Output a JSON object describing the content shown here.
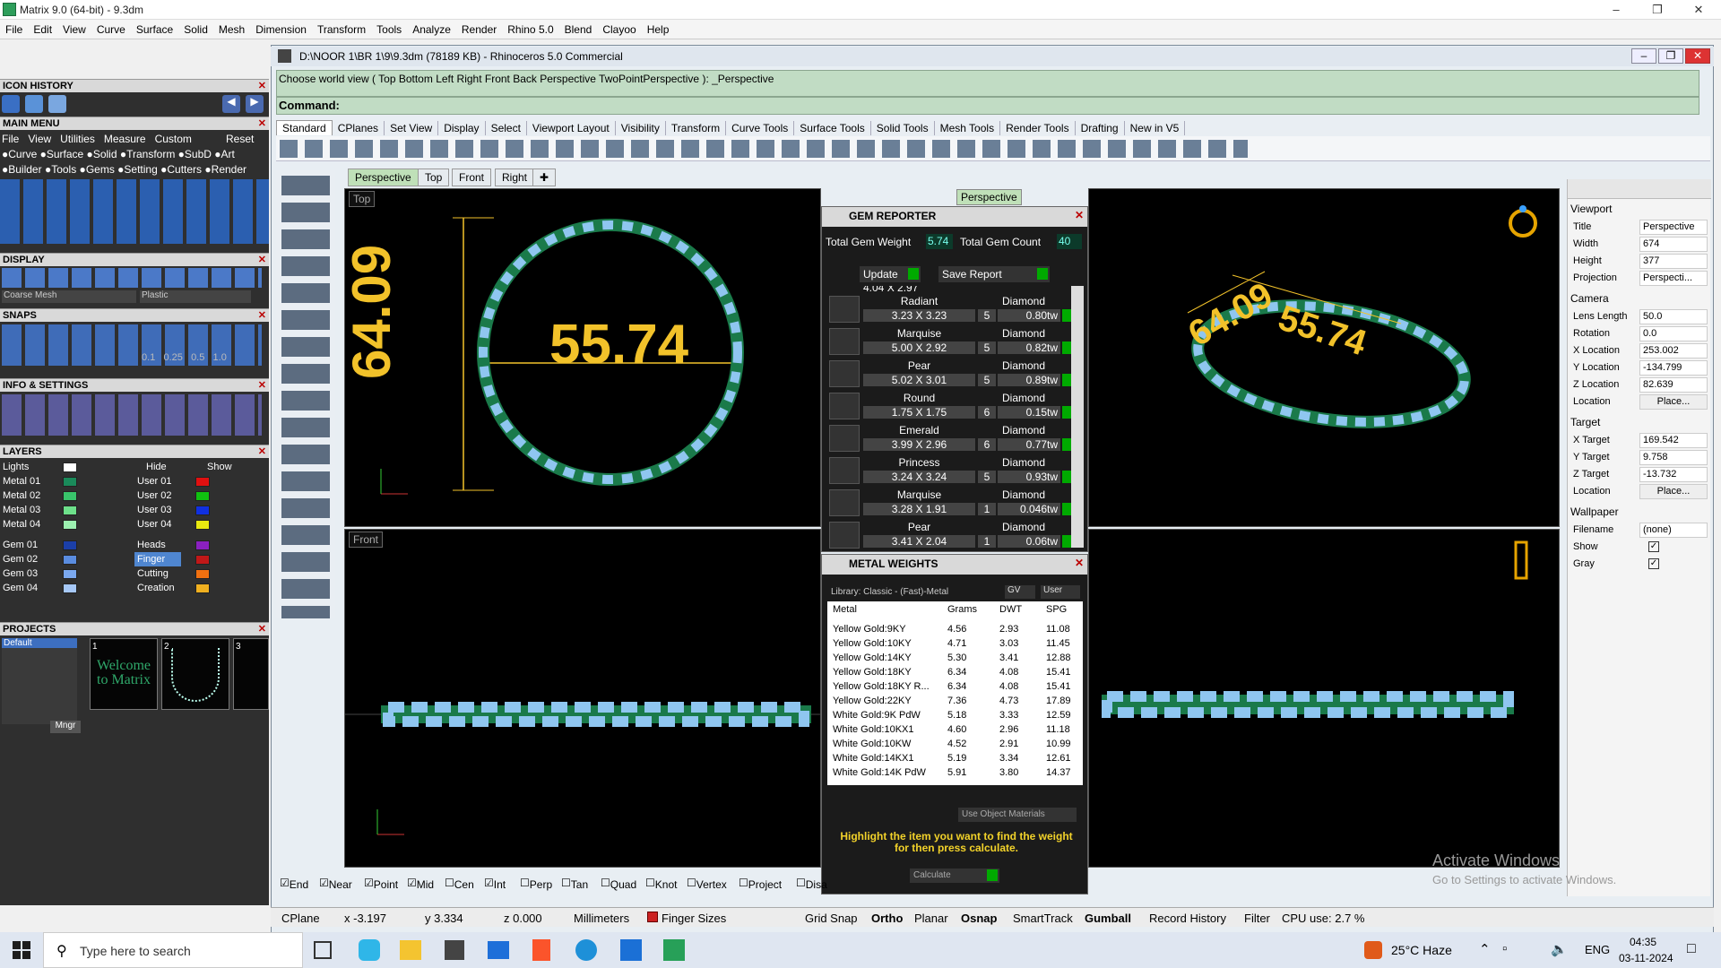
{
  "app": {
    "title": "Matrix 9.0 (64-bit) - 9.3dm"
  },
  "menu": [
    "File",
    "Edit",
    "View",
    "Curve",
    "Surface",
    "Solid",
    "Mesh",
    "Dimension",
    "Transform",
    "Tools",
    "Analyze",
    "Render",
    "Rhino 5.0",
    "Blend",
    "Clayoo",
    "Help"
  ],
  "left_panel": {
    "icon_history": "ICON HISTORY",
    "main_menu": "MAIN MENU",
    "mm_row1": [
      "File",
      "View",
      "Utilities",
      "Measure",
      "Custom",
      "Reset"
    ],
    "mm_row2": [
      "Curve",
      "Surface",
      "Solid",
      "Transform",
      "SubD",
      "Art"
    ],
    "mm_row3": [
      "Builder",
      "Tools",
      "Gems",
      "Setting",
      "Cutters",
      "Render"
    ],
    "display": "DISPLAY",
    "display_mode": "Coarse Mesh",
    "display_mat": "Plastic",
    "snaps": "SNAPS",
    "snap_vals": [
      "0.1",
      "0.25",
      "0.5",
      "1.0"
    ],
    "info": "INFO & SETTINGS",
    "layers": "LAYERS",
    "lights": "Lights",
    "hide": "Hide",
    "show": "Show",
    "layer_left": [
      "Metal 01",
      "Metal 02",
      "Metal 03",
      "Metal 04",
      "Gem 01",
      "Gem 02",
      "Gem 03",
      "Gem 04"
    ],
    "layer_right": [
      "User 01",
      "User 02",
      "User 03",
      "User 04",
      "Heads",
      "Finger",
      "Cutting",
      "Creation"
    ],
    "projects": "PROJECTS",
    "project_name": "Default",
    "thumbs": [
      "1",
      "2",
      "3"
    ],
    "welcome": "Welcome to Matrix",
    "mngr": "Mngr"
  },
  "rhino": {
    "title": "D:\\NOOR 1\\BR 1\\9\\9.3dm (78189 KB) - Rhinoceros 5.0 Commercial",
    "cmd_history": "Choose world view ( Top  Bottom  Left  Right  Front  Back  Perspective  TwoPointPerspective ): _Perspective",
    "cmd_label": "Command:",
    "tabs": [
      "Standard",
      "CPlanes",
      "Set View",
      "Display",
      "Select",
      "Viewport Layout",
      "Visibility",
      "Transform",
      "Curve Tools",
      "Surface Tools",
      "Solid Tools",
      "Mesh Tools",
      "Render Tools",
      "Drafting",
      "New in V5"
    ],
    "view_tabs": [
      "Perspective",
      "Top",
      "Front",
      "Right"
    ],
    "vp_top": "Top",
    "vp_persp": "Perspective",
    "vp_front": "Front",
    "dim_top_vert": "64.09",
    "dim_top_horiz": "55.74",
    "dim_persp_a": "64.09",
    "dim_persp_b": "55.74"
  },
  "gem_reporter": {
    "title": "GEM REPORTER",
    "total_weight_label": "Total Gem Weight",
    "total_weight": "5.74",
    "total_count_label": "Total Gem Count",
    "total_count": "40",
    "update": "Update",
    "save": "Save Report",
    "partial": "4.04 X 2.97",
    "rows": [
      {
        "name": "Radiant",
        "size": "3.23 X 3.23",
        "type": "Diamond",
        "count": "5",
        "wt": "0.80tw"
      },
      {
        "name": "Marquise",
        "size": "5.00 X 2.92",
        "type": "Diamond",
        "count": "5",
        "wt": "0.82tw"
      },
      {
        "name": "Pear",
        "size": "5.02 X 3.01",
        "type": "Diamond",
        "count": "5",
        "wt": "0.89tw"
      },
      {
        "name": "Round",
        "size": "1.75 X 1.75",
        "type": "Diamond",
        "count": "6",
        "wt": "0.15tw"
      },
      {
        "name": "Emerald",
        "size": "3.99 X 2.96",
        "type": "Diamond",
        "count": "6",
        "wt": "0.77tw"
      },
      {
        "name": "Princess",
        "size": "3.24 X 3.24",
        "type": "Diamond",
        "count": "5",
        "wt": "0.93tw"
      },
      {
        "name": "Marquise",
        "size": "3.28 X 1.91",
        "type": "Diamond",
        "count": "1",
        "wt": "0.046tw"
      },
      {
        "name": "Pear",
        "size": "3.41 X 2.04",
        "type": "Diamond",
        "count": "1",
        "wt": "0.06tw"
      }
    ]
  },
  "metal_weights": {
    "title": "METAL WEIGHTS",
    "library": "Library: Classic - (Fast)-Metal",
    "gv": "GV",
    "user": "User",
    "headers": [
      "Metal",
      "Grams",
      "DWT",
      "SPG"
    ],
    "rows": [
      [
        "Yellow Gold:9KY",
        "4.56",
        "2.93",
        "11.08"
      ],
      [
        "Yellow Gold:10KY",
        "4.71",
        "3.03",
        "11.45"
      ],
      [
        "Yellow Gold:14KY",
        "5.30",
        "3.41",
        "12.88"
      ],
      [
        "Yellow Gold:18KY",
        "6.34",
        "4.08",
        "15.41"
      ],
      [
        "Yellow Gold:18KY R...",
        "6.34",
        "4.08",
        "15.41"
      ],
      [
        "Yellow Gold:22KY",
        "7.36",
        "4.73",
        "17.89"
      ],
      [
        "White Gold:9K PdW",
        "5.18",
        "3.33",
        "12.59"
      ],
      [
        "White Gold:10KX1",
        "4.60",
        "2.96",
        "11.18"
      ],
      [
        "White Gold:10KW",
        "4.52",
        "2.91",
        "10.99"
      ],
      [
        "White Gold:14KX1",
        "5.19",
        "3.34",
        "12.61"
      ],
      [
        "White Gold:14K PdW",
        "5.91",
        "3.80",
        "14.37"
      ]
    ],
    "use_obj": "Use Object Materials",
    "hint": "Highlight the item you want to find the weight for then press calculate.",
    "calculate": "Calculate"
  },
  "properties": {
    "viewport": "Viewport",
    "rows1": [
      [
        "Title",
        "Perspective"
      ],
      [
        "Width",
        "674"
      ],
      [
        "Height",
        "377"
      ],
      [
        "Projection",
        "Perspecti..."
      ]
    ],
    "camera": "Camera",
    "rows2": [
      [
        "Lens Length",
        "50.0"
      ],
      [
        "Rotation",
        "0.0"
      ],
      [
        "X Location",
        "253.002"
      ],
      [
        "Y Location",
        "-134.799"
      ],
      [
        "Z Location",
        "82.639"
      ],
      [
        "Location",
        "Place..."
      ]
    ],
    "target": "Target",
    "rows3": [
      [
        "X Target",
        "169.542"
      ],
      [
        "Y Target",
        "9.758"
      ],
      [
        "Z Target",
        "-13.732"
      ],
      [
        "Location",
        "Place..."
      ]
    ],
    "wallpaper": "Wallpaper",
    "rows4": [
      [
        "Filename",
        "(none)"
      ],
      [
        "Show",
        ""
      ],
      [
        "Gray",
        ""
      ]
    ]
  },
  "osnaps": [
    "End",
    "Near",
    "Point",
    "Mid",
    "Cen",
    "Int",
    "Perp",
    "Tan",
    "Quad",
    "Knot",
    "Vertex",
    "Project",
    "Disa"
  ],
  "status": {
    "cplane": "CPlane",
    "x": "x -3.197",
    "y": "y 3.334",
    "z": "z 0.000",
    "units": "Millimeters",
    "layer": "Finger Sizes",
    "grid": "Grid Snap",
    "ortho": "Ortho",
    "planar": "Planar",
    "osnap": "Osnap",
    "smarttrack": "SmartTrack",
    "gumball": "Gumball",
    "record": "Record History",
    "filter": "Filter",
    "cpu": "CPU use: 2.7 %"
  },
  "watermark": {
    "line1": "Activate Windows",
    "line2": "Go to Settings to activate Windows."
  },
  "taskbar": {
    "search": "Type here to search",
    "weather": "25°C  Haze",
    "lang": "ENG",
    "time": "04:35",
    "date": "03-11-2024"
  },
  "colors": {
    "gem": "#8fc6f0",
    "metal": "#1a7a4a",
    "dim": "#f2c22a"
  }
}
